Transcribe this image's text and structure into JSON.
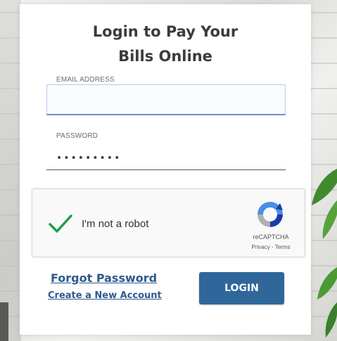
{
  "login_card": {
    "title_line1": "Login to Pay Your",
    "title_line2": "Bills Online",
    "email": {
      "label": "EMAIL ADDRESS",
      "value": ""
    },
    "password": {
      "label": "PASSWORD",
      "masked_value": "•••••••••"
    },
    "recaptcha": {
      "checkbox_state": "checked",
      "check_icon": "checkmark-icon",
      "label": "I'm not a robot",
      "brand": "reCAPTCHA",
      "links": "Privacy - Terms",
      "logo_icon": "recaptcha-logo-icon"
    },
    "forgot_password": "Forgot Password",
    "create_account": "Create a New Account",
    "login_button": "LOGIN"
  },
  "colors": {
    "link": "#2e5a8c",
    "button": "#2f679b",
    "check": "#1e9e4a"
  }
}
